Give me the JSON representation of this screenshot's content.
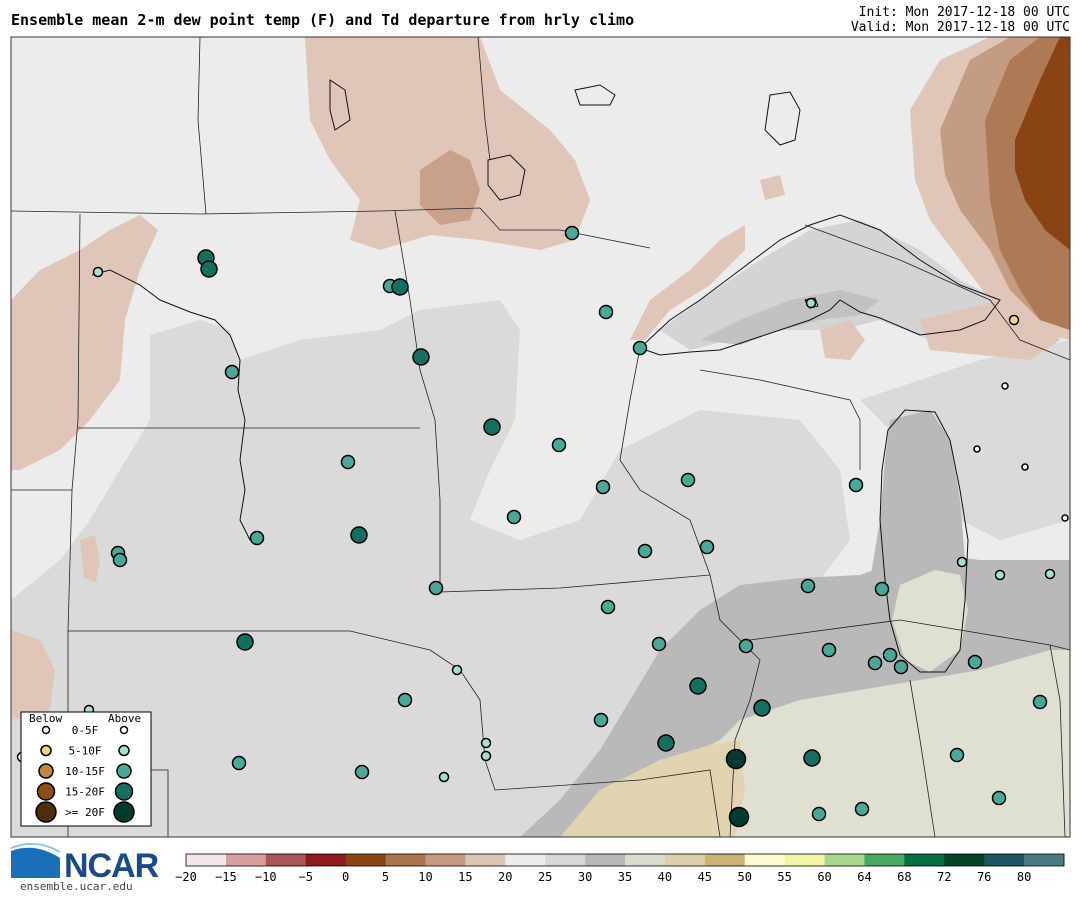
{
  "header": {
    "title": "Ensemble mean 2-m dew point temp (F) and Td departure from hrly climo",
    "init": "Init: Mon 2017-12-18 00 UTC",
    "valid": "Valid: Mon 2017-12-18 00 UTC"
  },
  "legend": {
    "below_label": "Below",
    "above_label": "Above",
    "rows": [
      {
        "label": "0-5F"
      },
      {
        "label": "5-10F"
      },
      {
        "label": "10-15F"
      },
      {
        "label": "15-20F"
      },
      {
        "label": ">= 20F"
      }
    ],
    "below_colors": [
      "#ffffff",
      "#f2d08f",
      "#c08838",
      "#8a5012",
      "#4e2e08"
    ],
    "above_colors": [
      "#ffffff",
      "#a8ddd4",
      "#4aa898",
      "#137060",
      "#043a30"
    ]
  },
  "colorbar": {
    "ticks": [
      "−20",
      "−15",
      "−10",
      "−5",
      "0",
      "5",
      "10",
      "15",
      "20",
      "25",
      "30",
      "35",
      "40",
      "45",
      "50",
      "55",
      "60",
      "64",
      "68",
      "72",
      "76",
      "80"
    ],
    "colors": [
      "#f4e6e6",
      "#d6a0a0",
      "#a85858",
      "#8c1c22",
      "#8a4414",
      "#aa7650",
      "#c49a80",
      "#dcc4b6",
      "#ececec",
      "#d8d8d8",
      "#b8b8b8",
      "#dcdccc",
      "#ddd0a8",
      "#c8b474",
      "#fffbd0",
      "#f4f4a8",
      "#a8d890",
      "#48aa60",
      "#087040",
      "#044428",
      "#1c5660",
      "#4a7a80"
    ]
  },
  "logo": {
    "name": "NCAR",
    "url": "ensemble.ucar.edu"
  },
  "colors": {
    "map_background": "#ececec",
    "above_dot": "#4aa898"
  }
}
